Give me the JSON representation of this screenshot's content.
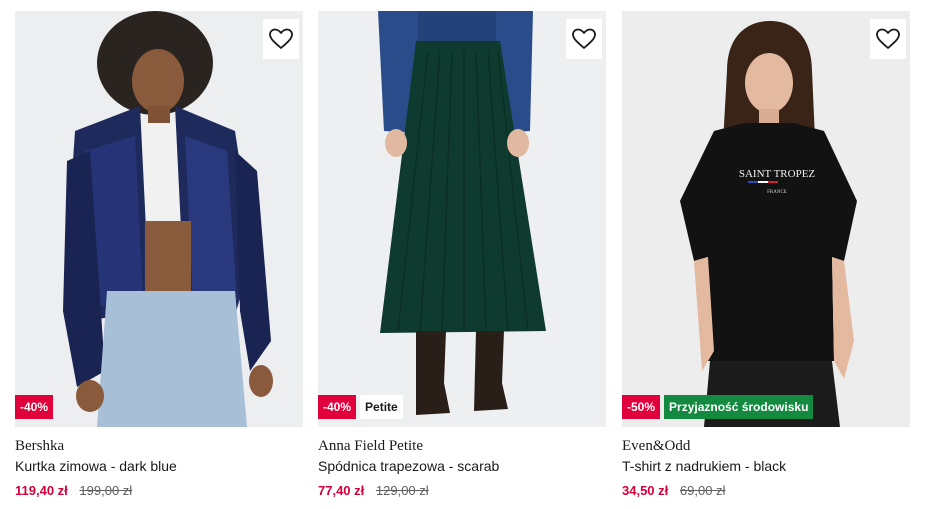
{
  "products": [
    {
      "brand": "Bershka",
      "name": "Kurtka zimowa - dark blue",
      "price": "119,40 zł",
      "old_price": "199,00 zł",
      "badges": {
        "discount": "-40%"
      },
      "icons": {
        "wishlist": "heart-icon"
      }
    },
    {
      "brand": "Anna Field Petite",
      "name": "Spódnica trapezowa - scarab",
      "price": "77,40 zł",
      "old_price": "129,00 zł",
      "badges": {
        "discount": "-40%",
        "tag": "Petite"
      },
      "icons": {
        "wishlist": "heart-icon"
      }
    },
    {
      "brand": "Even&Odd",
      "name": "T-shirt z nadrukiem - black",
      "price": "34,50 zł",
      "old_price": "69,00 zł",
      "badges": {
        "discount": "-50%",
        "eco": "Przyjazność środowisku"
      },
      "print": {
        "line1": "SAINT TROPEZ",
        "line2": "FRANCE"
      },
      "icons": {
        "wishlist": "heart-icon"
      }
    }
  ],
  "colors": {
    "discount": "#e0003c",
    "eco": "#138a3f",
    "price": "#d3003a"
  }
}
